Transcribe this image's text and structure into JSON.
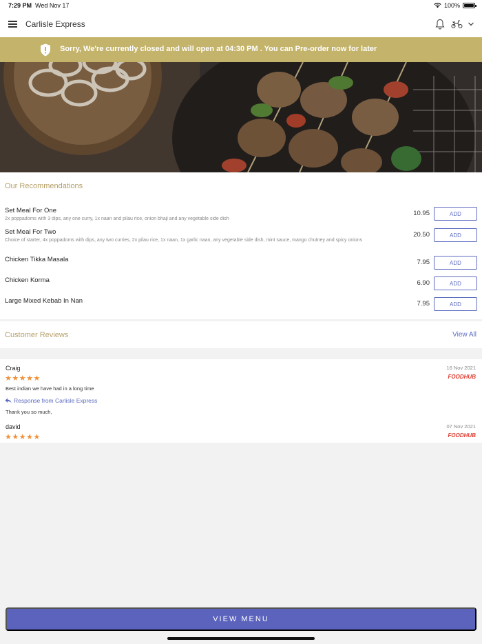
{
  "status_bar": {
    "time": "7:29 PM",
    "date": "Wed Nov 17",
    "battery": "100%"
  },
  "header": {
    "title": "Carlisle Express"
  },
  "banner": {
    "message": "Sorry, We're currently closed and will open at 04:30 PM . You can Pre-order now for later"
  },
  "recommendations": {
    "title": "Our Recommendations",
    "items": [
      {
        "name": "Set Meal For One",
        "description": "2x poppadoms with 3 dips, any one curry, 1x naan and pilau rice, onion bhaji and any vegetable side dish",
        "price": "10.95",
        "button": "ADD"
      },
      {
        "name": "Set Meal For Two",
        "description": "Choice of starter, 4x poppadoms with dips, any two curries, 2x pilau rice, 1x naan, 1x garlic naan, any vegetable side dish, mint sauce, mango chutney and spicy onions",
        "price": "20.50",
        "button": "ADD"
      },
      {
        "name": "Chicken Tikka Masala",
        "description": "",
        "price": "7.95",
        "button": "ADD"
      },
      {
        "name": "Chicken Korma",
        "description": "",
        "price": "6.90",
        "button": "ADD"
      },
      {
        "name": "Large Mixed Kebab In Nan",
        "description": "",
        "price": "7.95",
        "button": "ADD"
      }
    ]
  },
  "reviews": {
    "title": "Customer Reviews",
    "view_all": "View All",
    "items": [
      {
        "author": "Craig",
        "date": "16 Nov 2021",
        "rating": 5,
        "stars": "★★★★★",
        "source": "FOODHUB",
        "text": "Best indian we have had in a long time",
        "response_label": "Response from Carlisle Express",
        "response_text": "Thank you so much,"
      },
      {
        "author": "david",
        "date": "07 Nov 2021",
        "rating": 5,
        "stars": "★★★★★",
        "source": "FOODHUB"
      }
    ]
  },
  "footer": {
    "button": "VIEW MENU"
  },
  "colors": {
    "banner": "#c4b36b",
    "accent": "#5b63bd",
    "section_title": "#b59f68",
    "stars": "#f0913a",
    "source": "#e03a2e"
  }
}
